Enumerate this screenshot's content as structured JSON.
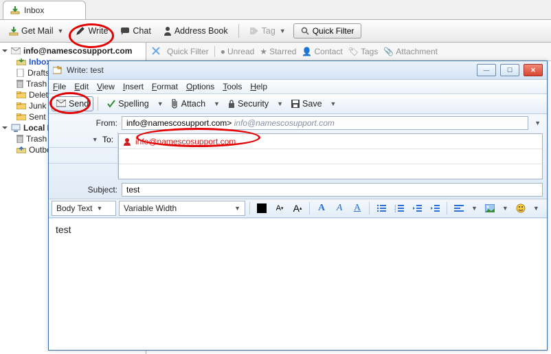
{
  "main": {
    "tab_label": "Inbox",
    "toolbar": {
      "get_mail": "Get Mail",
      "write": "Write",
      "chat": "Chat",
      "address_book": "Address Book",
      "tag": "Tag",
      "quick_filter": "Quick Filter"
    },
    "account_label": "info@namescosupport.com",
    "folders": {
      "inbox": "Inbox",
      "drafts": "Drafts",
      "trash": "Trash",
      "deleted": "Deleted",
      "junk": "Junk",
      "sent": "Sent"
    },
    "local_label": "Local Folders",
    "local_folders": {
      "trash": "Trash",
      "outbox": "Outbox"
    },
    "filter_row": {
      "quick_filter": "Quick Filter",
      "unread": "Unread",
      "starred": "Starred",
      "contact": "Contact",
      "tags": "Tags",
      "attachment": "Attachment"
    }
  },
  "compose": {
    "window_title": "Write: test",
    "menus": {
      "file": "File",
      "edit": "Edit",
      "view": "View",
      "insert": "Insert",
      "format": "Format",
      "options": "Options",
      "tools": "Tools",
      "help": "Help"
    },
    "toolbar": {
      "send": "Send",
      "spelling": "Spelling",
      "attach": "Attach",
      "security": "Security",
      "save": "Save"
    },
    "headers": {
      "from_label": "From:",
      "from_value": "info@namescosupport.com>",
      "from_grey": "info@namescosupport.com",
      "to_label": "To:",
      "to_value": "info@namescosupport.com",
      "subject_label": "Subject:",
      "subject_value": "test"
    },
    "format": {
      "paragraph": "Body Text",
      "font": "Variable Width"
    },
    "body": "test"
  }
}
